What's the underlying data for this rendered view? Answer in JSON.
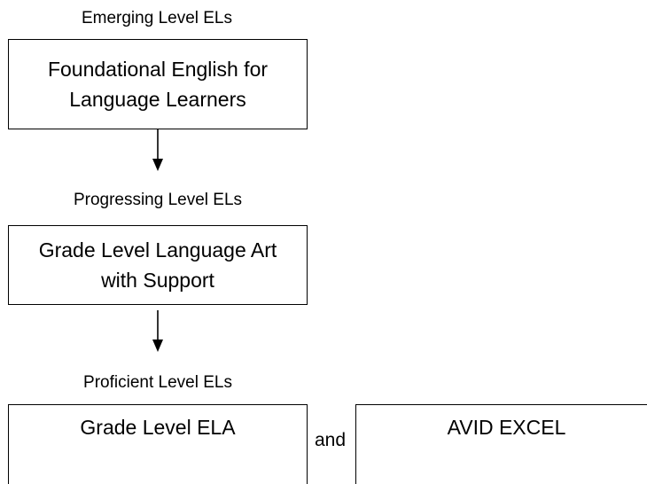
{
  "diagram": {
    "emerging": {
      "label": "Emerging Level ELs",
      "box_lines": [
        "Foundational English for",
        "Language Learners"
      ]
    },
    "progressing": {
      "label": "Progressing Level ELs",
      "box_lines": [
        "Grade Level Language Art",
        "with Support"
      ]
    },
    "proficient": {
      "label": "Proficient Level ELs",
      "box_left": "Grade Level ELA",
      "connector": "and",
      "box_right": "AVID EXCEL"
    },
    "line_color": "#000000",
    "background": "#ffffff"
  }
}
